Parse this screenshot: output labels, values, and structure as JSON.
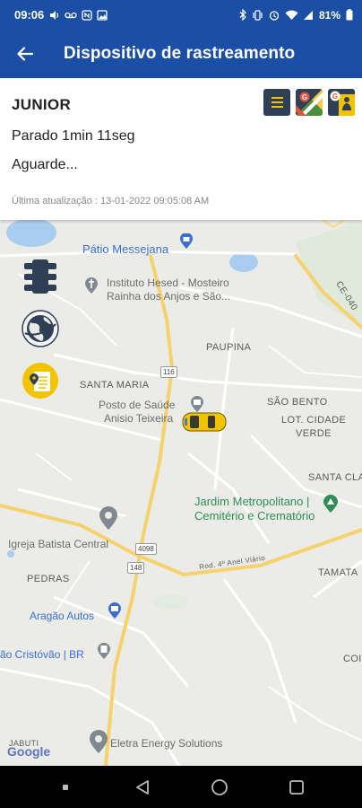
{
  "status_bar": {
    "time": "09:06",
    "battery": "81%",
    "icons_left": [
      "volume-icon",
      "voicemail-icon",
      "nfc-icon",
      "gallery-icon"
    ],
    "icons_right": [
      "bluetooth-icon",
      "vibrate-icon",
      "alarm-icon",
      "wifi-icon",
      "signal-icon"
    ]
  },
  "app_bar": {
    "title": "Dispositivo de rastreamento",
    "back_icon": "arrow-left-icon"
  },
  "card": {
    "name": "JUNIOR",
    "status": "Parado 1min 11seg",
    "address": "Aguarde...",
    "updated": "Última atualização : 13-01-2022 09:05:08 AM",
    "buttons": [
      "menu-icon",
      "google-maps-icon",
      "google-street-view-icon"
    ],
    "accent_color": "#f2c400"
  },
  "map": {
    "labels": {
      "patio": "Pátio Messejana",
      "instituto_1": "Instituto Hesed - Mosteiro",
      "instituto_2": "Rainha dos Anjos e São...",
      "paupina": "PAUPINA",
      "ce040": "CE-040",
      "santa_maria": "SANTA MARIA",
      "posto_1": "Posto de Saúde",
      "posto_2": "Anisio Teixeira",
      "sao_bento": "SÃO BENTO",
      "lot_1": "LOT. CIDADE",
      "lot_2": "VERDE",
      "santa_cla": "SANTA CLA",
      "jardim_1": "Jardim Metropolitano |",
      "jardim_2": "Cemitério e Crematório",
      "igreja": "Igreja Batista Central",
      "pedras": "PEDRAS",
      "rod": "Rod. 4º Anel Viário",
      "tamata": "TAMATA",
      "aragao": "Aragão Autos",
      "sao_cristovao": "ão Cristóvão | BR",
      "coi": "COI",
      "eletra": "Eletra Energy Solutions",
      "jabuti": "JABUTI",
      "google": "Google"
    },
    "shields": {
      "s116": "116",
      "s4098": "4098",
      "s148": "148"
    },
    "side_buttons": [
      "traffic-light-icon",
      "globe-icon",
      "address-icon"
    ]
  },
  "nav_bar": [
    "menu-dot-icon",
    "back-triangle-icon",
    "home-circle-icon",
    "recents-square-icon"
  ]
}
